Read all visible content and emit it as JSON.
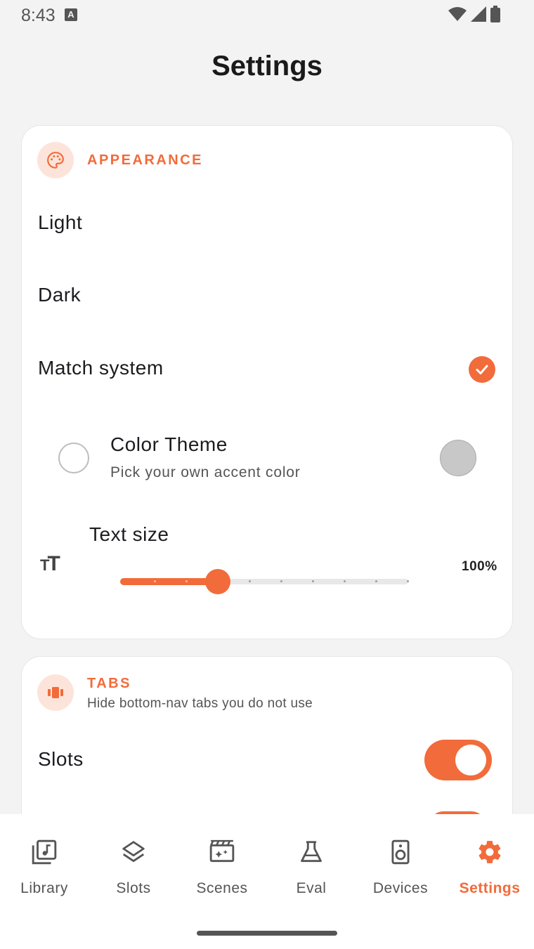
{
  "status_bar": {
    "time": "8:43",
    "notification_glyph": "A"
  },
  "page": {
    "title": "Settings"
  },
  "appearance": {
    "section_title": "APPEARANCE",
    "modes": [
      {
        "label": "Light",
        "selected": false
      },
      {
        "label": "Dark",
        "selected": false
      },
      {
        "label": "Match system",
        "selected": true
      }
    ],
    "color_theme": {
      "title": "Color Theme",
      "subtitle": "Pick your own accent color",
      "enabled": false,
      "swatch_color": "#c9c8c8"
    },
    "text_size": {
      "title": "Text size",
      "value_label": "100%",
      "slider_fraction": 0.33,
      "steps": 10,
      "icon_text": "T"
    }
  },
  "tabs": {
    "section_title": "TABS",
    "subtitle": "Hide bottom-nav tabs you do not use",
    "items": [
      {
        "label": "Slots",
        "on": true
      }
    ]
  },
  "bottom_nav": {
    "items": [
      {
        "label": "Library",
        "icon": "library-icon",
        "active": false
      },
      {
        "label": "Slots",
        "icon": "layers-icon",
        "active": false
      },
      {
        "label": "Scenes",
        "icon": "movie-icon",
        "active": false
      },
      {
        "label": "Eval",
        "icon": "flask-icon",
        "active": false
      },
      {
        "label": "Devices",
        "icon": "speaker-icon",
        "active": false
      },
      {
        "label": "Settings",
        "icon": "gear-icon",
        "active": true
      }
    ]
  },
  "colors": {
    "accent": "#f26b3a",
    "accent_soft": "#fde4da",
    "background": "#f3f3f3",
    "card": "#ffffff"
  }
}
